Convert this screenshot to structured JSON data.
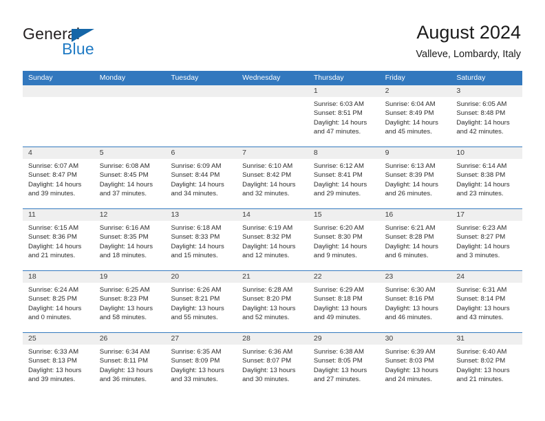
{
  "brand": {
    "name_part1": "General",
    "name_part2": "Blue",
    "flag_icon": "triangle-flag-icon",
    "accent_color": "#1f7ac4",
    "flag_color": "#1566a8"
  },
  "header": {
    "title": "August 2024",
    "subtitle": "Valleve, Lombardy, Italy"
  },
  "calendar": {
    "header_bg": "#3278be",
    "header_text_color": "#ffffff",
    "day_number_bg": "#efefef",
    "weekdays": [
      "Sunday",
      "Monday",
      "Tuesday",
      "Wednesday",
      "Thursday",
      "Friday",
      "Saturday"
    ],
    "weeks": [
      [
        {
          "day": "",
          "lines": []
        },
        {
          "day": "",
          "lines": []
        },
        {
          "day": "",
          "lines": []
        },
        {
          "day": "",
          "lines": []
        },
        {
          "day": "1",
          "lines": [
            "Sunrise: 6:03 AM",
            "Sunset: 8:51 PM",
            "Daylight: 14 hours",
            "and 47 minutes."
          ]
        },
        {
          "day": "2",
          "lines": [
            "Sunrise: 6:04 AM",
            "Sunset: 8:49 PM",
            "Daylight: 14 hours",
            "and 45 minutes."
          ]
        },
        {
          "day": "3",
          "lines": [
            "Sunrise: 6:05 AM",
            "Sunset: 8:48 PM",
            "Daylight: 14 hours",
            "and 42 minutes."
          ]
        }
      ],
      [
        {
          "day": "4",
          "lines": [
            "Sunrise: 6:07 AM",
            "Sunset: 8:47 PM",
            "Daylight: 14 hours",
            "and 39 minutes."
          ]
        },
        {
          "day": "5",
          "lines": [
            "Sunrise: 6:08 AM",
            "Sunset: 8:45 PM",
            "Daylight: 14 hours",
            "and 37 minutes."
          ]
        },
        {
          "day": "6",
          "lines": [
            "Sunrise: 6:09 AM",
            "Sunset: 8:44 PM",
            "Daylight: 14 hours",
            "and 34 minutes."
          ]
        },
        {
          "day": "7",
          "lines": [
            "Sunrise: 6:10 AM",
            "Sunset: 8:42 PM",
            "Daylight: 14 hours",
            "and 32 minutes."
          ]
        },
        {
          "day": "8",
          "lines": [
            "Sunrise: 6:12 AM",
            "Sunset: 8:41 PM",
            "Daylight: 14 hours",
            "and 29 minutes."
          ]
        },
        {
          "day": "9",
          "lines": [
            "Sunrise: 6:13 AM",
            "Sunset: 8:39 PM",
            "Daylight: 14 hours",
            "and 26 minutes."
          ]
        },
        {
          "day": "10",
          "lines": [
            "Sunrise: 6:14 AM",
            "Sunset: 8:38 PM",
            "Daylight: 14 hours",
            "and 23 minutes."
          ]
        }
      ],
      [
        {
          "day": "11",
          "lines": [
            "Sunrise: 6:15 AM",
            "Sunset: 8:36 PM",
            "Daylight: 14 hours",
            "and 21 minutes."
          ]
        },
        {
          "day": "12",
          "lines": [
            "Sunrise: 6:16 AM",
            "Sunset: 8:35 PM",
            "Daylight: 14 hours",
            "and 18 minutes."
          ]
        },
        {
          "day": "13",
          "lines": [
            "Sunrise: 6:18 AM",
            "Sunset: 8:33 PM",
            "Daylight: 14 hours",
            "and 15 minutes."
          ]
        },
        {
          "day": "14",
          "lines": [
            "Sunrise: 6:19 AM",
            "Sunset: 8:32 PM",
            "Daylight: 14 hours",
            "and 12 minutes."
          ]
        },
        {
          "day": "15",
          "lines": [
            "Sunrise: 6:20 AM",
            "Sunset: 8:30 PM",
            "Daylight: 14 hours",
            "and 9 minutes."
          ]
        },
        {
          "day": "16",
          "lines": [
            "Sunrise: 6:21 AM",
            "Sunset: 8:28 PM",
            "Daylight: 14 hours",
            "and 6 minutes."
          ]
        },
        {
          "day": "17",
          "lines": [
            "Sunrise: 6:23 AM",
            "Sunset: 8:27 PM",
            "Daylight: 14 hours",
            "and 3 minutes."
          ]
        }
      ],
      [
        {
          "day": "18",
          "lines": [
            "Sunrise: 6:24 AM",
            "Sunset: 8:25 PM",
            "Daylight: 14 hours",
            "and 0 minutes."
          ]
        },
        {
          "day": "19",
          "lines": [
            "Sunrise: 6:25 AM",
            "Sunset: 8:23 PM",
            "Daylight: 13 hours",
            "and 58 minutes."
          ]
        },
        {
          "day": "20",
          "lines": [
            "Sunrise: 6:26 AM",
            "Sunset: 8:21 PM",
            "Daylight: 13 hours",
            "and 55 minutes."
          ]
        },
        {
          "day": "21",
          "lines": [
            "Sunrise: 6:28 AM",
            "Sunset: 8:20 PM",
            "Daylight: 13 hours",
            "and 52 minutes."
          ]
        },
        {
          "day": "22",
          "lines": [
            "Sunrise: 6:29 AM",
            "Sunset: 8:18 PM",
            "Daylight: 13 hours",
            "and 49 minutes."
          ]
        },
        {
          "day": "23",
          "lines": [
            "Sunrise: 6:30 AM",
            "Sunset: 8:16 PM",
            "Daylight: 13 hours",
            "and 46 minutes."
          ]
        },
        {
          "day": "24",
          "lines": [
            "Sunrise: 6:31 AM",
            "Sunset: 8:14 PM",
            "Daylight: 13 hours",
            "and 43 minutes."
          ]
        }
      ],
      [
        {
          "day": "25",
          "lines": [
            "Sunrise: 6:33 AM",
            "Sunset: 8:13 PM",
            "Daylight: 13 hours",
            "and 39 minutes."
          ]
        },
        {
          "day": "26",
          "lines": [
            "Sunrise: 6:34 AM",
            "Sunset: 8:11 PM",
            "Daylight: 13 hours",
            "and 36 minutes."
          ]
        },
        {
          "day": "27",
          "lines": [
            "Sunrise: 6:35 AM",
            "Sunset: 8:09 PM",
            "Daylight: 13 hours",
            "and 33 minutes."
          ]
        },
        {
          "day": "28",
          "lines": [
            "Sunrise: 6:36 AM",
            "Sunset: 8:07 PM",
            "Daylight: 13 hours",
            "and 30 minutes."
          ]
        },
        {
          "day": "29",
          "lines": [
            "Sunrise: 6:38 AM",
            "Sunset: 8:05 PM",
            "Daylight: 13 hours",
            "and 27 minutes."
          ]
        },
        {
          "day": "30",
          "lines": [
            "Sunrise: 6:39 AM",
            "Sunset: 8:03 PM",
            "Daylight: 13 hours",
            "and 24 minutes."
          ]
        },
        {
          "day": "31",
          "lines": [
            "Sunrise: 6:40 AM",
            "Sunset: 8:02 PM",
            "Daylight: 13 hours",
            "and 21 minutes."
          ]
        }
      ]
    ]
  }
}
